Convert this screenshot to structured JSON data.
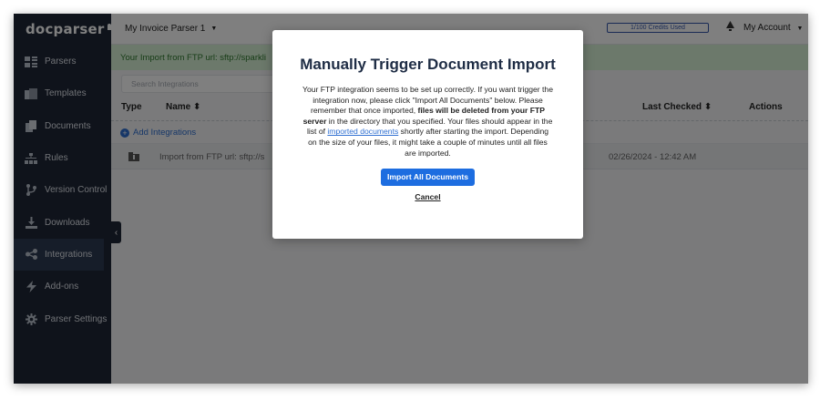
{
  "app": {
    "logo_text": "docparser"
  },
  "sidebar": {
    "items": [
      {
        "label": "Parsers",
        "icon": "parsers-icon"
      },
      {
        "label": "Templates",
        "icon": "templates-icon"
      },
      {
        "label": "Documents",
        "icon": "documents-icon"
      },
      {
        "label": "Rules",
        "icon": "rules-icon"
      },
      {
        "label": "Version Control",
        "icon": "version-control-icon"
      },
      {
        "label": "Downloads",
        "icon": "downloads-icon"
      },
      {
        "label": "Integrations",
        "icon": "integrations-icon",
        "active": true
      },
      {
        "label": "Add-ons",
        "icon": "add-ons-icon"
      },
      {
        "label": "Parser Settings",
        "icon": "parser-settings-icon"
      }
    ]
  },
  "topbar": {
    "parser_name": "My Invoice Parser 1",
    "credits": "1/100 Credits Used",
    "account": "My Account"
  },
  "banner": {
    "text": "Your Import from FTP url: sftp://sparkli"
  },
  "search": {
    "placeholder": "Search Integrations"
  },
  "table": {
    "columns": {
      "type": "Type",
      "name": "Name",
      "last_checked": "Last Checked",
      "actions": "Actions"
    },
    "add_label": "Add Integrations",
    "rows": [
      {
        "name": "Import from FTP url: sftp://s",
        "last_checked": "02/26/2024 - 12:42 AM"
      }
    ]
  },
  "modal": {
    "title": "Manually Trigger Document Import",
    "body_1": "Your FTP integration seems to be set up correctly. If you want trigger the integration now, please click \"Import All Documents\" below. Please remember that once imported, ",
    "body_bold": "files will be deleted from your FTP server",
    "body_2": " in the directory that you specified. Your files should appear in the list of ",
    "body_link": "imported documents",
    "body_3": " shortly after starting the import. Depending on the size of your files, it might take a couple of minutes until all files are imported.",
    "import_button": "Import All Documents",
    "cancel_button": "Cancel"
  },
  "colors": {
    "sidebar_bg": "#1e2637",
    "primary_button": "#1d6de0",
    "banner_bg": "#d9f2d6",
    "link": "#2f6fd1"
  }
}
